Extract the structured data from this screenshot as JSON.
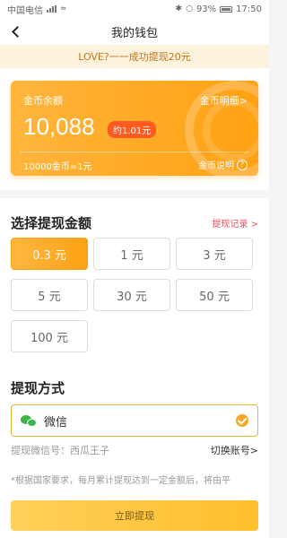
{
  "status_bar": {
    "carrier": "中国电信",
    "battery": "93%",
    "time": "17:50"
  },
  "header": {
    "title": "我的钱包"
  },
  "notice": {
    "text": "LOVE?一一成功提现20元"
  },
  "balance_card": {
    "label": "金币余额",
    "detail_link": "金币明细>",
    "amount": "10,088",
    "equivalent": "约1.01元",
    "rate": "10000金币=1元",
    "explain_link": "金币说明"
  },
  "withdraw_amount": {
    "title": "选择提现金额",
    "records_link": "提现记录 >",
    "options": [
      {
        "label": "0.3 元",
        "selected": true
      },
      {
        "label": "1 元",
        "selected": false
      },
      {
        "label": "3 元",
        "selected": false
      },
      {
        "label": "5 元",
        "selected": false
      },
      {
        "label": "30 元",
        "selected": false
      },
      {
        "label": "50 元",
        "selected": false
      },
      {
        "label": "100 元",
        "selected": false
      }
    ]
  },
  "withdraw_method": {
    "title": "提现方式",
    "method_name": "微信",
    "account_label": "提现微信号：西瓜王子",
    "switch_account": "切换账号>",
    "note": "*根据国家要求，每月累计提现达到一定金额后，将由平"
  },
  "submit": {
    "label": "立即提现"
  },
  "colors": {
    "accent": "#ffa112",
    "badge": "#ff5a22",
    "link_red": "#e8505b",
    "wechat_green": "#3bb64a"
  }
}
